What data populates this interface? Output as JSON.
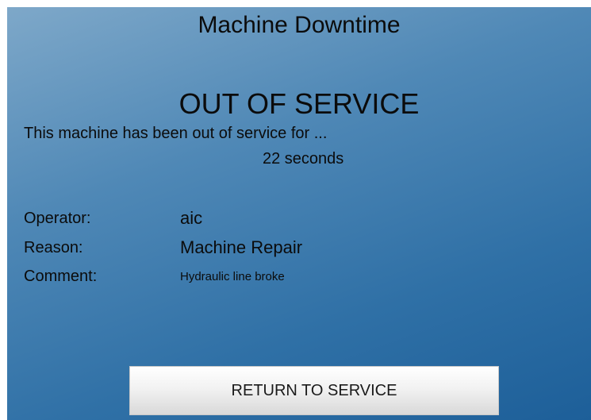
{
  "title": "Machine Downtime",
  "status": "OUT OF SERVICE",
  "message": "This machine has been out of service for ...",
  "duration": "22 seconds",
  "fields": {
    "operator": {
      "label": "Operator:",
      "value": "aic"
    },
    "reason": {
      "label": "Reason:",
      "value": "Machine Repair"
    },
    "comment": {
      "label": "Comment:",
      "value": "Hydraulic line broke"
    }
  },
  "button": {
    "label": "RETURN TO SERVICE"
  },
  "colors": {
    "background_top": "#7ea8c9",
    "background_bottom": "#1d5f99",
    "text": "#0b0b0b",
    "button_bg": "#f2f2f2"
  }
}
